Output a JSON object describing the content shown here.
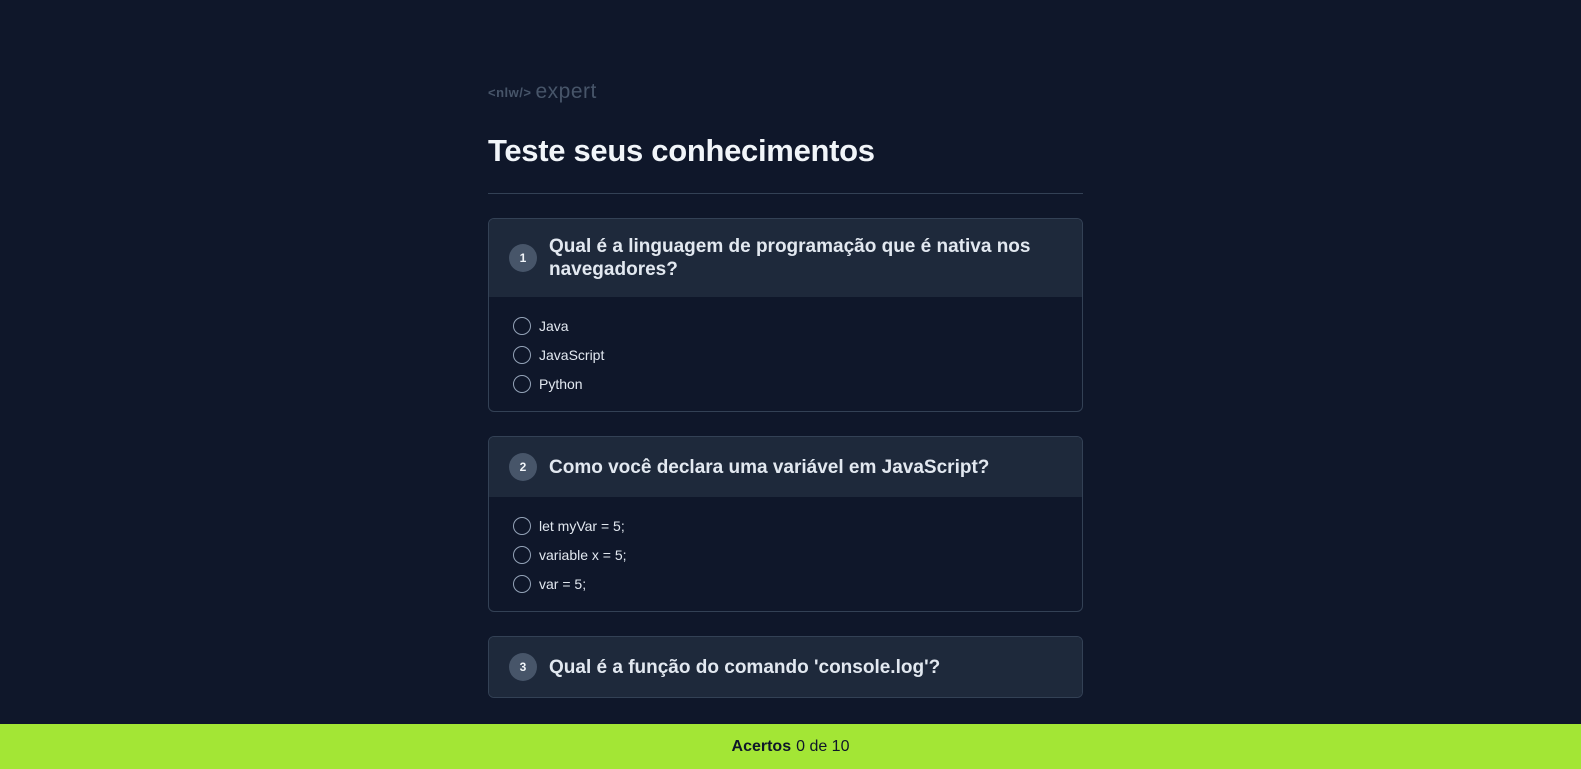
{
  "logo": {
    "tag": "<nlw/>",
    "word": "expert"
  },
  "page_title": "Teste seus conhecimentos",
  "questions": [
    {
      "number": "1",
      "text": "Qual é a linguagem de programação que é nativa nos navegadores?",
      "options": [
        "Java",
        "JavaScript",
        "Python"
      ]
    },
    {
      "number": "2",
      "text": "Como você declara uma variável em JavaScript?",
      "options": [
        "let myVar = 5;",
        "variable x = 5;",
        "var = 5;"
      ]
    },
    {
      "number": "3",
      "text": "Qual é a função do comando 'console.log'?"
    }
  ],
  "footer": {
    "label": "Acertos",
    "score": "0 de 10"
  },
  "colors": {
    "background": "#0f172a",
    "card_header": "#1e293b",
    "accent": "#a3e635"
  }
}
